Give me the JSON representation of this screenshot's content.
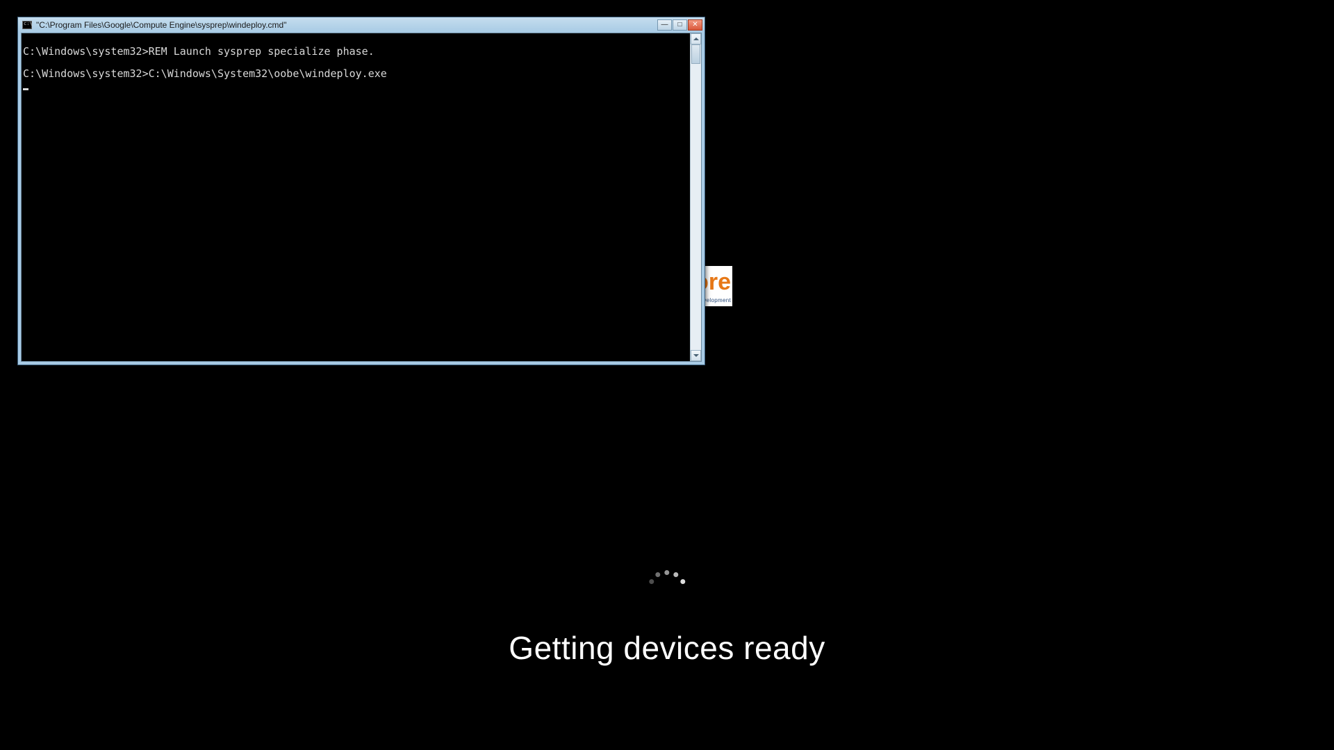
{
  "oobe": {
    "message": "Getting devices ready"
  },
  "stray_widget": {
    "fragment_large": "ore",
    "fragment_small": "velopment"
  },
  "cmd": {
    "title": "\"C:\\Program Files\\Google\\Compute Engine\\sysprep\\windeploy.cmd\"",
    "lines": [
      "",
      "C:\\Windows\\system32>REM Launch sysprep specialize phase.",
      "",
      "C:\\Windows\\system32>C:\\Windows\\System32\\oobe\\windeploy.exe"
    ],
    "buttons": {
      "minimize_glyph": "—",
      "maximize_glyph": "□",
      "close_glyph": "✕"
    }
  }
}
